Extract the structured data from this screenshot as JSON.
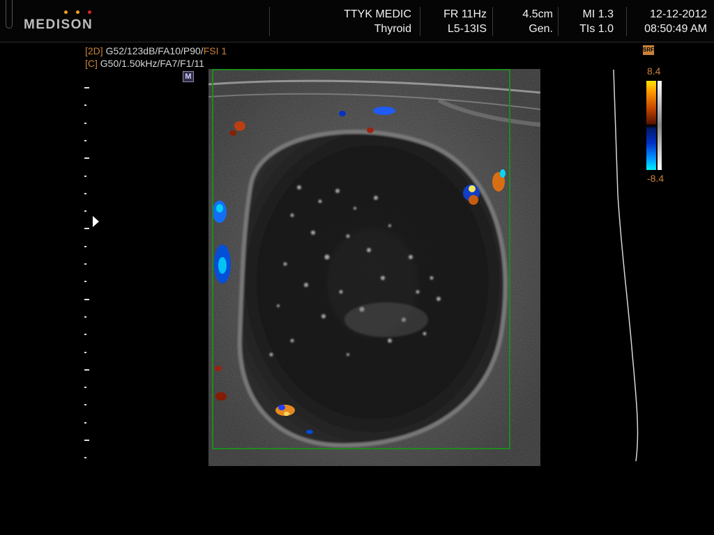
{
  "header": {
    "brand": "MEDISON",
    "site": "TTYK MEDIC",
    "preset": "Thyroid",
    "frame_rate": "FR 11Hz",
    "probe": "L5-13IS",
    "depth": "4.5cm",
    "mode": "Gen.",
    "mi": "MI 1.3",
    "tis": "TIs 1.0",
    "date": "12-12-2012",
    "time": "08:50:49 AM"
  },
  "params": {
    "line1_tag": "[2D]",
    "line1_a": " G52/123dB/FA10/P90/",
    "line1_b": "FSI 1",
    "line2_tag": "[C]",
    "line2_a": " G50/1.50kHz/FA7/F1/11",
    "badge": "M"
  },
  "colorbar": {
    "icon": "SRF",
    "max": "8.4",
    "min": "-8.4"
  },
  "colors": {
    "accent_orange": "#c8823a",
    "roi_box": "#1f8a1f",
    "logo_dots": [
      "#f0a020",
      "#f0a020",
      "#e02020"
    ]
  },
  "image": {
    "description_icon": "ultrasound-thyroid-scan"
  }
}
